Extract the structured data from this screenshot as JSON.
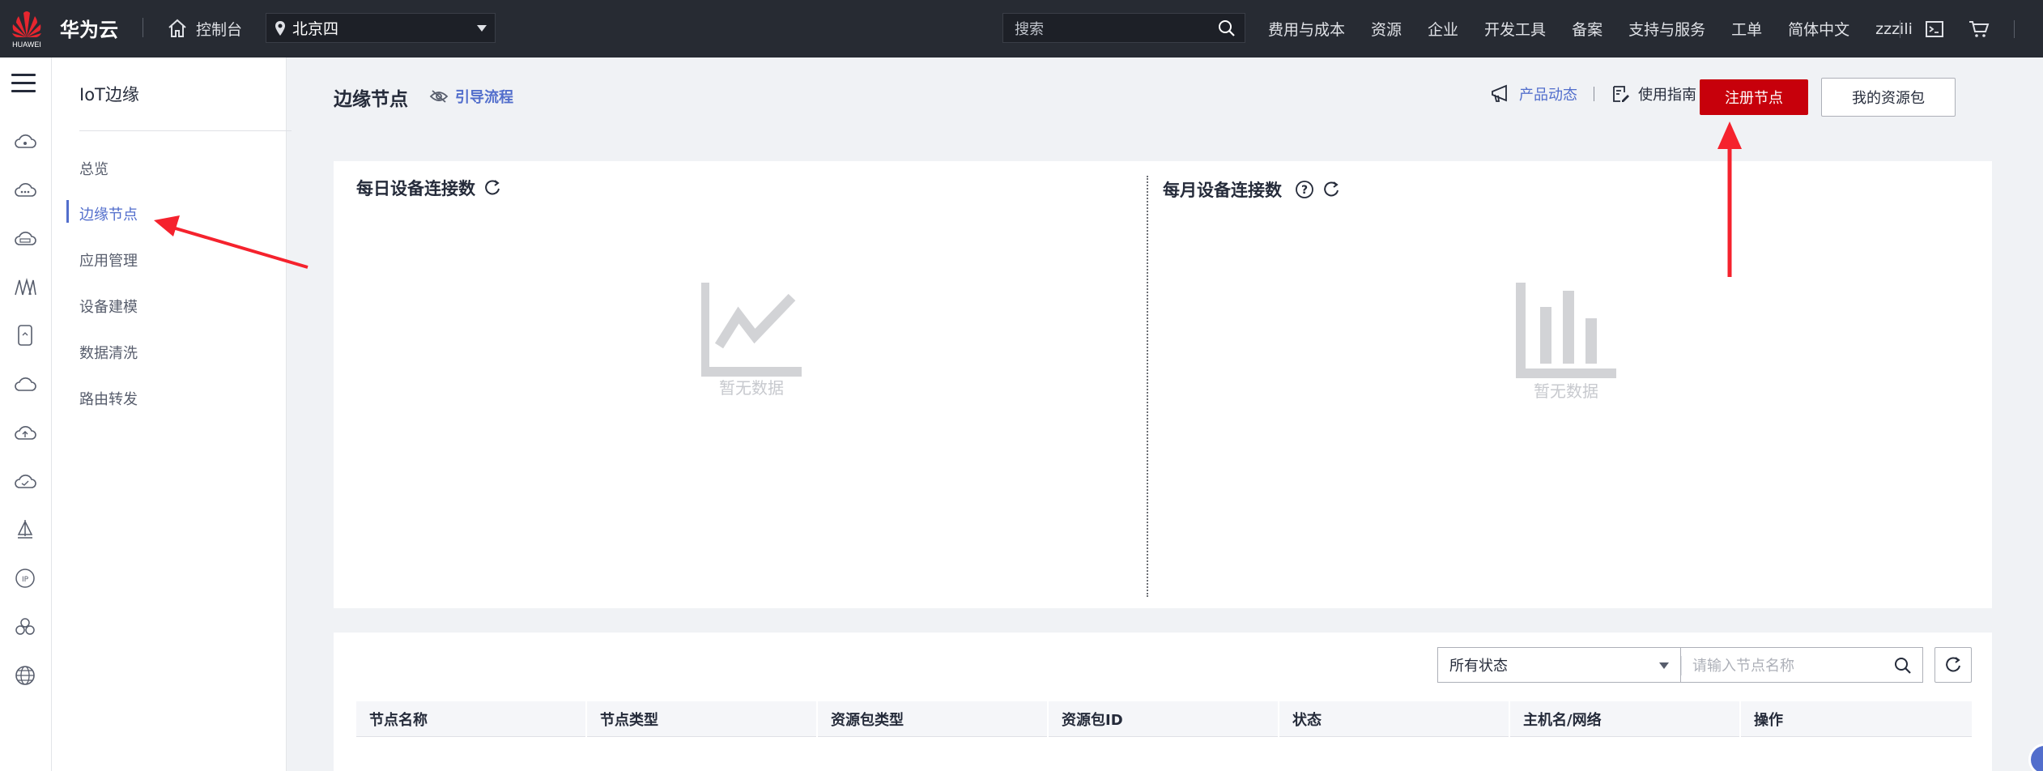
{
  "topbar": {
    "logo_text": "HUAWEI",
    "brand": "华为云",
    "console": "控制台",
    "region": "北京四",
    "search_placeholder": "搜索",
    "nav": [
      "费用与成本",
      "资源",
      "企业",
      "开发工具",
      "备案",
      "支持与服务",
      "工单",
      "简体中文",
      "zzzili"
    ]
  },
  "rail": {
    "icons": [
      "cloud-icon",
      "cloud-dots-icon",
      "cloud-badge-icon",
      "arch-icon",
      "phone-icon",
      "cloud-outline-icon",
      "cloud-upload-icon",
      "cloud-check-icon",
      "sailboat-icon",
      "ip-icon",
      "cluster-icon",
      "globe-icon"
    ]
  },
  "sidebar": {
    "title": "IoT边缘",
    "items": [
      {
        "label": "总览",
        "active": false
      },
      {
        "label": "边缘节点",
        "active": true
      },
      {
        "label": "应用管理",
        "active": false
      },
      {
        "label": "设备建模",
        "active": false
      },
      {
        "label": "数据清洗",
        "active": false
      },
      {
        "label": "路由转发",
        "active": false
      }
    ]
  },
  "header": {
    "title": "边缘节点",
    "guide_label": "引导流程",
    "product_news": "产品动态",
    "user_guide": "使用指南",
    "register_button": "注册节点",
    "package_button": "我的资源包"
  },
  "charts": {
    "daily_title": "每日设备连接数",
    "monthly_title": "每月设备连接数",
    "empty_text": "暂无数据"
  },
  "table": {
    "status_filter": "所有状态",
    "name_placeholder": "请输入节点名称",
    "columns": [
      "节点名称",
      "节点类型",
      "资源包类型",
      "资源包ID",
      "状态",
      "主机名/网络",
      "操作"
    ]
  },
  "colors": {
    "topbar_bg": "#272b33",
    "accent": "#526ecc",
    "primary_button": "#c7000b",
    "annotation_arrow": "#f5222d"
  }
}
